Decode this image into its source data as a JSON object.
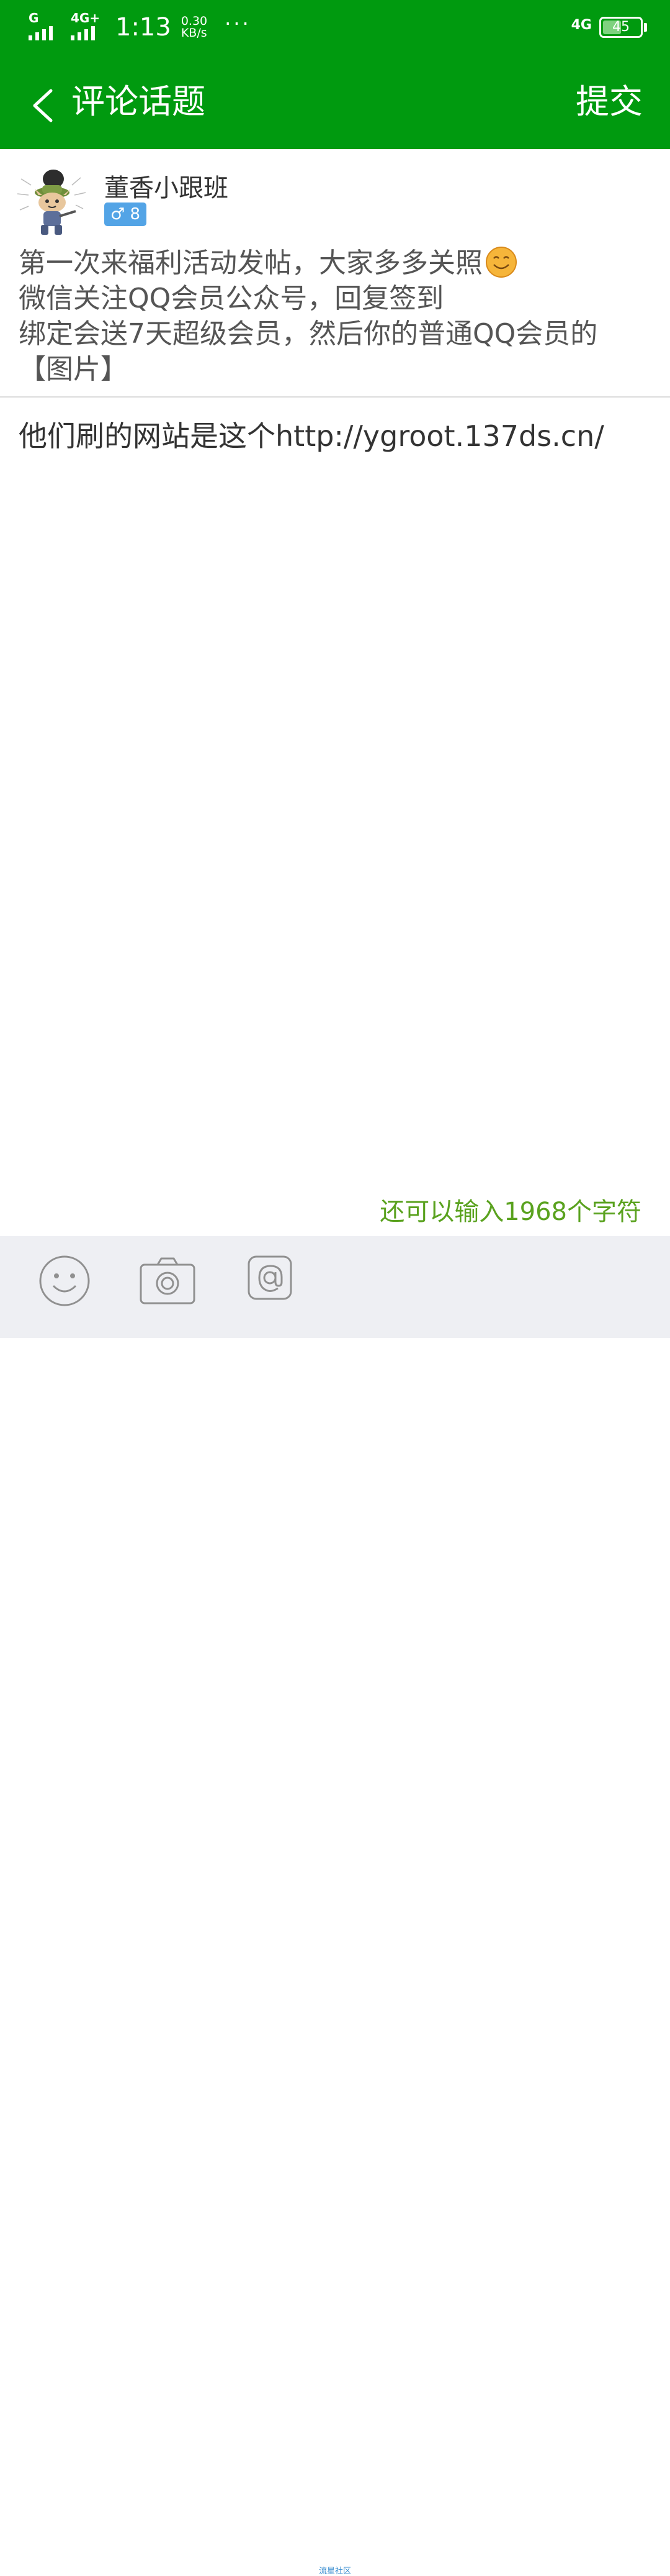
{
  "status_bar": {
    "signal1_label": "G",
    "signal2_label": "4G+",
    "time": "1:13",
    "speed_value": "0.30",
    "speed_unit": "KB/s",
    "more": "···",
    "network": "4G",
    "battery": "45"
  },
  "header": {
    "back_icon": "chevron-left-icon",
    "title": "评论话题",
    "submit_label": "提交"
  },
  "post": {
    "username": "董香小跟班",
    "badge": "♂ 8",
    "lines": [
      "第一次来福利活动发帖，大家多多关照",
      "微信关注QQ会员公众号，回复签到",
      "绑定会送7天超级会员，然后你的普通QQ会员的",
      "【图片】"
    ],
    "emoji": "smile-emoji"
  },
  "reply": {
    "text": "他们刷的网站是这个http://ygroot.137ds.cn/"
  },
  "counter": {
    "text": "还可以输入1968个字符"
  },
  "toolbar": {
    "icons": [
      "smile-icon",
      "camera-icon",
      "at-icon"
    ]
  },
  "footer": {
    "watermark": "流星社区"
  },
  "colors": {
    "header_green": "#009a0f",
    "counter_green": "#5aa21f",
    "badge_blue": "#53a4e6",
    "toolbar_bg": "#eeeff3"
  }
}
